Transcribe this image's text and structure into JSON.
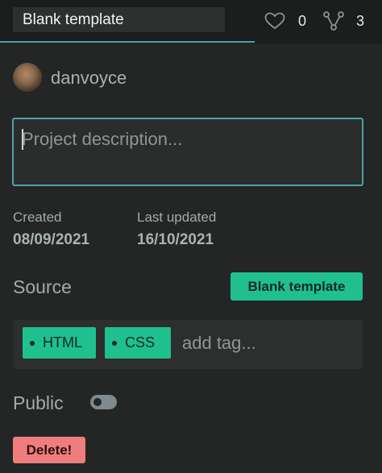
{
  "header": {
    "title_value": "Blank template",
    "likes": "0",
    "forks": "3"
  },
  "user": {
    "name": "danvoyce"
  },
  "description": {
    "placeholder": "Project description..."
  },
  "dates": {
    "created_label": "Created",
    "created_value": "08/09/2021",
    "updated_label": "Last updated",
    "updated_value": "16/10/2021"
  },
  "source": {
    "label": "Source",
    "button_label": "Blank template"
  },
  "tags": {
    "items": [
      "HTML",
      "CSS"
    ],
    "placeholder": "add tag..."
  },
  "public": {
    "label": "Public",
    "enabled": false
  },
  "actions": {
    "delete_label": "Delete!"
  },
  "colors": {
    "accent": "#1fc08e",
    "border_teal": "#4aa3a6",
    "danger": "#f07d7d",
    "background": "#242525"
  },
  "icons": {
    "like": "heart-icon",
    "fork": "fork-icon"
  }
}
